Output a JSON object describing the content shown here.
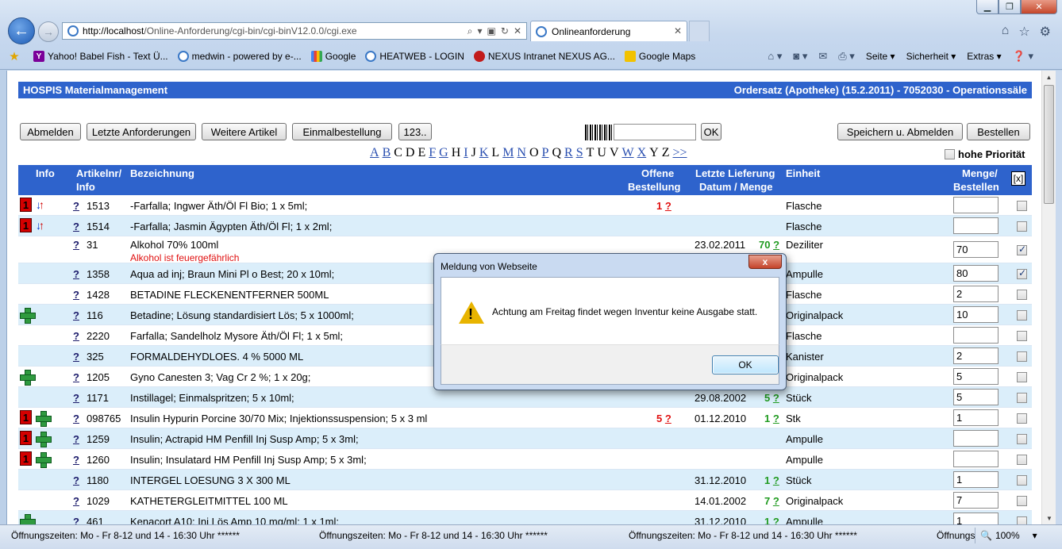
{
  "browser": {
    "url_host": "http://localhost",
    "url_path": "/Online-Anforderung/cgi-bin/cgi-binV12.0.0/cgi.exe",
    "tab_title": "Onlineanforderung",
    "favorites": [
      {
        "icon": "yahoo-icon",
        "label": "Yahoo! Babel Fish - Text Ü..."
      },
      {
        "icon": "ie-page-icon",
        "label": "medwin - powered by e-..."
      },
      {
        "icon": "google-icon",
        "label": "Google"
      },
      {
        "icon": "ie-page-icon",
        "label": "HEATWEB - LOGIN"
      },
      {
        "icon": "nexus-icon",
        "label": "NEXUS Intranet NEXUS AG..."
      },
      {
        "icon": "google-maps-icon",
        "label": "Google Maps"
      }
    ],
    "commands": {
      "seite": "Seite",
      "sicherheit": "Sicherheit",
      "extras": "Extras"
    }
  },
  "app": {
    "title": "HOSPIS Materialmanagement",
    "subtitle": "Ordersatz (Apotheke) (15.2.2011) - 7052030 - Operationssäle"
  },
  "buttons": {
    "abmelden": "Abmelden",
    "letzte": "Letzte Anforderungen",
    "weitere": "Weitere Artikel",
    "einmal": "Einmalbestellung",
    "num": "123..",
    "ok": "OK",
    "speichern": "Speichern u. Abmelden",
    "bestellen": "Bestellen"
  },
  "alphabet": [
    {
      "l": "A",
      "link": true
    },
    {
      "l": "B",
      "link": true
    },
    {
      "l": "C",
      "link": false
    },
    {
      "l": "D",
      "link": false
    },
    {
      "l": "E",
      "link": false
    },
    {
      "l": "F",
      "link": true
    },
    {
      "l": "G",
      "link": true
    },
    {
      "l": "H",
      "link": false
    },
    {
      "l": "I",
      "link": true
    },
    {
      "l": "J",
      "link": false
    },
    {
      "l": "K",
      "link": true
    },
    {
      "l": "L",
      "link": false
    },
    {
      "l": "M",
      "link": true
    },
    {
      "l": "N",
      "link": true
    },
    {
      "l": "O",
      "link": false
    },
    {
      "l": "P",
      "link": true
    },
    {
      "l": "Q",
      "link": false
    },
    {
      "l": "R",
      "link": true
    },
    {
      "l": "S",
      "link": true
    },
    {
      "l": "T",
      "link": false
    },
    {
      "l": "U",
      "link": false
    },
    {
      "l": "V",
      "link": false
    },
    {
      "l": "W",
      "link": true
    },
    {
      "l": "X",
      "link": true
    },
    {
      "l": "Y",
      "link": false
    },
    {
      "l": "Z",
      "link": false
    },
    {
      "l": ">>",
      "link": true
    }
  ],
  "priority_label": "hohe Priorität",
  "table": {
    "h_info": "Info",
    "h_artnr1": "Artikelnr/",
    "h_artnr2": "Info",
    "h_bez": "Bezeichnung",
    "h_off1": "Offene",
    "h_off2": "Bestellung",
    "h_lief1": "Letzte Lieferung",
    "h_lief2": "Datum / Menge",
    "h_einheit": "Einheit",
    "h_menge1": "Menge/",
    "h_menge2": "Bestellen",
    "h_x": "[x]"
  },
  "rows": [
    {
      "badge": true,
      "arrows": true,
      "cross": false,
      "nr": "1513",
      "bez": "-Farfalla; Ingwer Äth/Öl Fl Bio; 1 x 5ml;",
      "offen": "1",
      "datum": "",
      "menge": "",
      "einheit": "Flasche",
      "qty": "",
      "checked": false
    },
    {
      "badge": true,
      "arrows": true,
      "cross": false,
      "nr": "1514",
      "bez": "-Farfalla; Jasmin Ägypten Äth/Öl Fl; 1 x 2ml;",
      "offen": "",
      "datum": "",
      "menge": "",
      "einheit": "Flasche",
      "qty": "",
      "checked": false
    },
    {
      "badge": false,
      "arrows": false,
      "cross": false,
      "nr": "31",
      "bez": "Alkohol 70% 100ml",
      "warn": "Alkohol ist feuergefährlich",
      "offen": "",
      "datum": "23.02.2011",
      "menge": "70",
      "einheit": "Deziliter",
      "qty": "70",
      "checked": true
    },
    {
      "badge": false,
      "arrows": false,
      "cross": false,
      "nr": "1358",
      "bez": "Aqua ad inj; Braun Mini Pl o Best; 20 x 10ml;",
      "offen": "",
      "datum": "",
      "menge": "",
      "einheit": "Ampulle",
      "qty": "80",
      "checked": true
    },
    {
      "badge": false,
      "arrows": false,
      "cross": false,
      "nr": "1428",
      "bez": "BETADINE FLECKENENTFERNER 500ML",
      "offen": "",
      "datum": "",
      "menge": "",
      "einheit": "Flasche",
      "qty": "2",
      "checked": false
    },
    {
      "badge": false,
      "arrows": false,
      "cross": true,
      "nr": "116",
      "bez": "Betadine; Lösung standardisiert Lös; 5 x 1000ml;",
      "offen": "",
      "datum": "",
      "menge": "",
      "einheit": "Originalpack",
      "qty": "10",
      "checked": false
    },
    {
      "badge": false,
      "arrows": false,
      "cross": false,
      "nr": "2220",
      "bez": "Farfalla; Sandelholz Mysore Äth/Öl Fl; 1 x 5ml;",
      "offen": "",
      "datum": "",
      "menge": "",
      "einheit": "Flasche",
      "qty": "",
      "checked": false
    },
    {
      "badge": false,
      "arrows": false,
      "cross": false,
      "nr": "325",
      "bez": "FORMALDEHYDLOES. 4 % 5000 ML",
      "offen": "",
      "datum": "",
      "menge": "",
      "einheit": "Kanister",
      "qty": "2",
      "checked": false
    },
    {
      "badge": false,
      "arrows": false,
      "cross": true,
      "nr": "1205",
      "bez": "Gyno Canesten 3; Vag Cr 2 %; 1 x 20g;",
      "offen": "",
      "datum": "",
      "menge": "",
      "einheit": "Originalpack",
      "qty": "5",
      "checked": false
    },
    {
      "badge": false,
      "arrows": false,
      "cross": false,
      "nr": "1171",
      "bez": "Instillagel; Einmalspritzen; 5 x 10ml;",
      "offen": "",
      "datum": "29.08.2002",
      "menge": "5",
      "einheit": "Stück",
      "qty": "5",
      "checked": false
    },
    {
      "badge": true,
      "arrows": false,
      "cross": true,
      "nr": "098765",
      "bez": "Insulin Hypurin Porcine 30/70 Mix; Injektionssuspension; 5 x 3 ml",
      "offen": "5",
      "datum": "01.12.2010",
      "menge": "1",
      "einheit": "Stk",
      "qty": "1",
      "checked": false
    },
    {
      "badge": true,
      "arrows": false,
      "cross": true,
      "nr": "1259",
      "bez": "Insulin; Actrapid HM Penfill Inj Susp Amp; 5 x 3ml;",
      "offen": "",
      "datum": "",
      "menge": "",
      "einheit": "Ampulle",
      "qty": "",
      "checked": false
    },
    {
      "badge": true,
      "arrows": false,
      "cross": true,
      "nr": "1260",
      "bez": "Insulin; Insulatard HM Penfill Inj Susp Amp; 5 x 3ml;",
      "offen": "",
      "datum": "",
      "menge": "",
      "einheit": "Ampulle",
      "qty": "",
      "checked": false
    },
    {
      "badge": false,
      "arrows": false,
      "cross": false,
      "nr": "1180",
      "bez": "INTERGEL LOESUNG 3 X 300 ML",
      "offen": "",
      "datum": "31.12.2010",
      "menge": "1",
      "einheit": "Stück",
      "qty": "1",
      "checked": false
    },
    {
      "badge": false,
      "arrows": false,
      "cross": false,
      "nr": "1029",
      "bez": "KATHETERGLEITMITTEL 100 ML",
      "offen": "",
      "datum": "14.01.2002",
      "menge": "7",
      "einheit": "Originalpack",
      "qty": "7",
      "checked": false
    },
    {
      "badge": false,
      "arrows": false,
      "cross": true,
      "nr": "461",
      "bez": "Kenacort A10; Inj Lös Amp 10 mg/ml; 1 x 1ml;",
      "offen": "",
      "datum": "31.12.2010",
      "menge": "1",
      "einheit": "Ampulle",
      "qty": "1",
      "checked": false
    }
  ],
  "modal": {
    "title": "Meldung von Webseite",
    "close": "x",
    "message": "Achtung am Freitag findet wegen Inventur keine Ausgabe statt.",
    "ok": "OK"
  },
  "status": {
    "s1": "Öffnungszeiten: Mo - Fr 8-12 und 14 - 16:30 Uhr ******",
    "s2": "Öffnungszeiten: Mo - Fr 8-12 und 14 - 16:30 Uhr ******",
    "s3": "Öffnungszeiten: Mo - Fr 8-12 und 14 - 16:30 Uhr ******",
    "s4": "Öffnungs",
    "zoom": "100%"
  },
  "colors": {
    "header_blue": "#2e63cc",
    "row_alt": "#dbeefa",
    "badge_red": "#d40000",
    "cross_green": "#2f9a3f"
  }
}
